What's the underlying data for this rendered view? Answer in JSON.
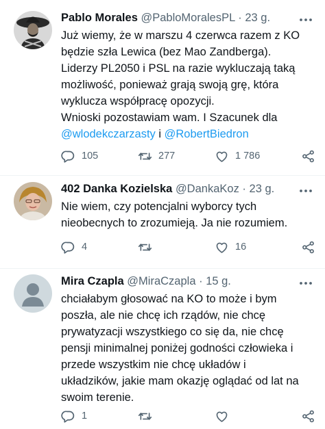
{
  "tweets": [
    {
      "name": "Pablo Morales",
      "handle": "@PabloMoralesPL",
      "dot": "·",
      "time": "23 g.",
      "lines": [
        "Już wiemy, że w marszu 4 czerwca razem z KO",
        "będzie szła Lewica (bez Mao Zandberga).",
        "Liderzy PL2050 i PSL na razie wykluczają taką",
        "możliwość, ponieważ grają swoją grę, która",
        "wyklucza współpracę opozycji.",
        "Wnioski pozostawiam wam. I Szacunek dla"
      ],
      "mention1": "@wlodekczarzasty",
      "conj": " i ",
      "mention2": "@RobertBiedron",
      "reply_count": "105",
      "retweet_count": "277",
      "like_count": "1 786"
    },
    {
      "name": "402 Danka Kozielska",
      "handle": "@DankaKoz",
      "dot": "·",
      "time": "23 g.",
      "lines": [
        "Nie wiem, czy potencjalni wyborcy tych",
        "nieobecnych to zrozumieją. Ja nie rozumiem."
      ],
      "reply_count": "4",
      "retweet_count": "",
      "like_count": "16"
    },
    {
      "name": "Mira Czapla",
      "handle": "@MiraCzapla",
      "dot": "·",
      "time": "15 g.",
      "lines": [
        "chciałabym głosować na KO to może i bym",
        "poszła, ale nie chcę ich rządów, nie chcę",
        "prywatyzacji wszystkiego co się da, nie chcę",
        "pensji minimalnej poniżej godności człowieka i",
        "przede wszystkim nie chcę układów i",
        "układzików, jakie mam okazję oglądać od lat na",
        "swoim terenie."
      ],
      "reply_count": "1",
      "retweet_count": "",
      "like_count": ""
    }
  ],
  "icons": {
    "more": "more-horizontal-icon",
    "reply": "reply-bubble-icon",
    "retweet": "retweet-arrows-icon",
    "like": "heart-icon",
    "share": "share-network-icon"
  },
  "colors": {
    "text": "#0f1419",
    "secondary": "#536471",
    "link": "#1d9bf0",
    "divider": "#eff3f4"
  }
}
